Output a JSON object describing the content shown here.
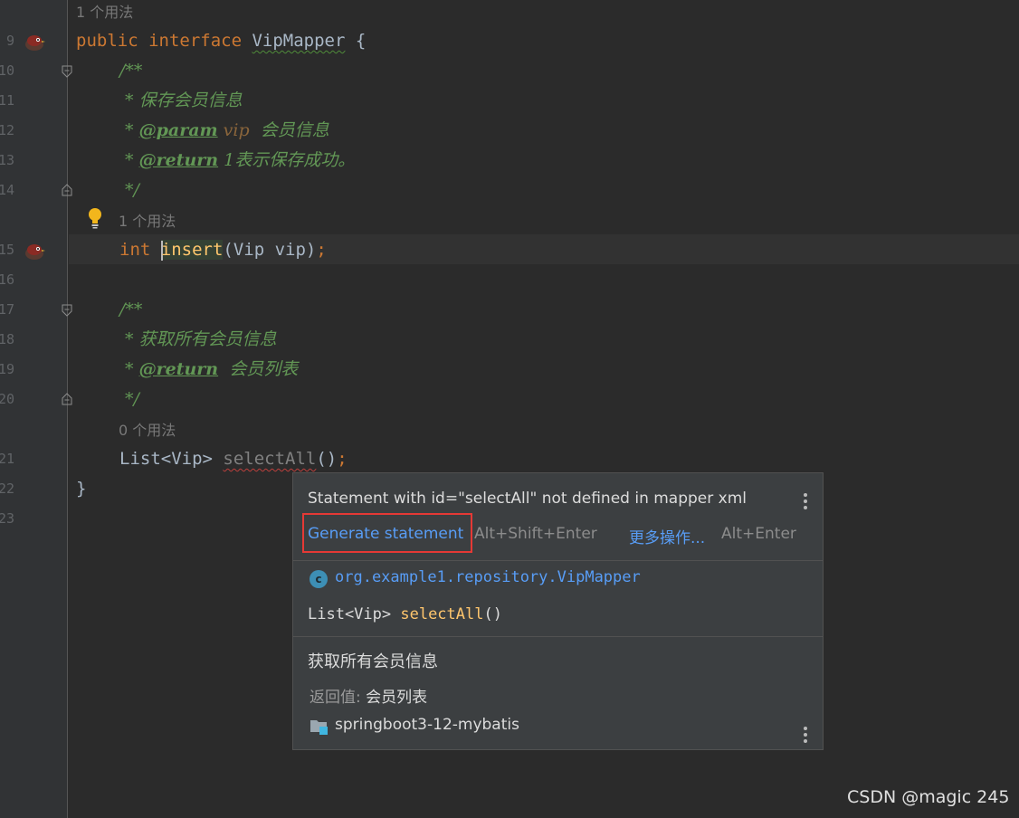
{
  "editor": {
    "line_numbers": [
      "9",
      "10",
      "11",
      "12",
      "13",
      "14",
      "15",
      "16",
      "17",
      "18",
      "19",
      "20",
      "21",
      "22",
      "23"
    ],
    "usage_hints": {
      "top": "1 个用法",
      "insert": "1 个用法",
      "select_all": "0 个用法"
    },
    "code": {
      "iface_kw": "public interface ",
      "iface_name": "VipMapper",
      "iface_brace": " {",
      "doc_open": "/**",
      "doc1_desc": " * 保存会员信息",
      "doc1_param_star": " * ",
      "doc1_param_tag": "@param",
      "doc1_param_name": " vip",
      "doc1_param_desc": "  会员信息",
      "doc1_return_star": " * ",
      "doc1_return_tag": "@return",
      "doc1_return_desc": " 1表示保存成功。",
      "doc_close": " */",
      "insert_type": "int ",
      "insert_name_first": "i",
      "insert_name_rest": "nsert",
      "insert_args": "(Vip vip)",
      "semicolon": ";",
      "doc2_desc": " * 获取所有会员信息",
      "doc2_return_star": " * ",
      "doc2_return_tag": "@return",
      "doc2_return_desc": "  会员列表",
      "select_type": "List<Vip> ",
      "select_name": "selectAll",
      "select_parens": "()",
      "close_brace": "}"
    }
  },
  "popup": {
    "message": "Statement with id=\"selectAll\" not defined in mapper xml",
    "generate_action": "Generate statement",
    "generate_shortcut": "Alt+Shift+Enter",
    "more_actions": "更多操作...",
    "more_shortcut": "Alt+Enter",
    "class_fqn": "org.example1.repository.VipMapper",
    "class_icon_letter": "c",
    "signature_type": "List<Vip> ",
    "signature_method": "selectAll",
    "signature_parens": "()",
    "description": "获取所有会员信息",
    "return_label": "返回值:",
    "return_value": " 会员列表",
    "module": "springboot3-12-mybatis"
  },
  "watermark": "CSDN @magic 245",
  "colors": {
    "keyword": "#cc7832",
    "doc": "#629755",
    "method": "#ffc66d",
    "link": "#589df6",
    "highlight_box": "#e53935"
  }
}
